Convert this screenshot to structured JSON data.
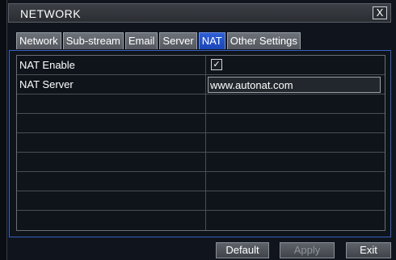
{
  "window": {
    "title": "NETWORK",
    "close_label": "X"
  },
  "tabs": [
    {
      "label": "Network",
      "active": false
    },
    {
      "label": "Sub-stream",
      "active": false
    },
    {
      "label": "Email",
      "active": false
    },
    {
      "label": "Server",
      "active": false
    },
    {
      "label": "NAT",
      "active": true
    },
    {
      "label": "Other Settings",
      "active": false
    }
  ],
  "nat": {
    "enable_label": "NAT Enable",
    "enable_checked": true,
    "enable_check_glyph": "✓",
    "server_label": "NAT Server",
    "server_value": "www.autonat.com"
  },
  "buttons": {
    "default": "Default",
    "apply": "Apply",
    "exit": "Exit"
  },
  "colors": {
    "accent": "#2d5fd6",
    "panel_border": "#3a5fc0"
  }
}
